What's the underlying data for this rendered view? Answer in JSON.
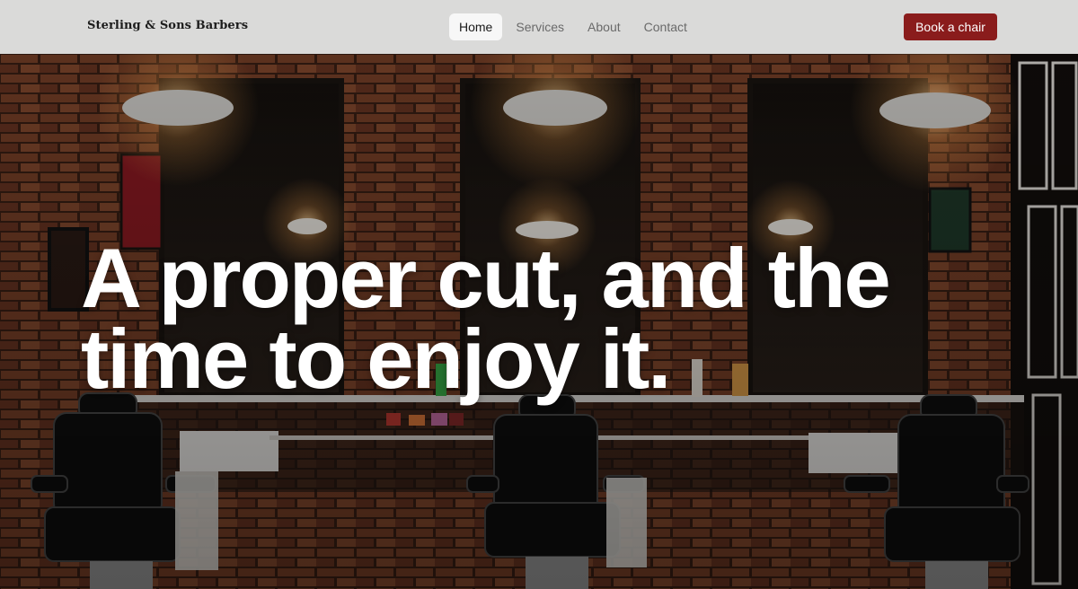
{
  "brand": {
    "name": "Sterling & Sons Barbers"
  },
  "nav": {
    "items": [
      {
        "label": "Home",
        "active": true
      },
      {
        "label": "Services",
        "active": false
      },
      {
        "label": "About",
        "active": false
      },
      {
        "label": "Contact",
        "active": false
      }
    ],
    "cta_label": "Book a chair"
  },
  "hero": {
    "headline": "A proper cut, and the time to enjoy it.",
    "image_alt": "barber-shop-interior"
  },
  "colors": {
    "nav_background": "#dadad9",
    "cta_background": "#8a1c1c",
    "headline_text": "#ffffff",
    "brick": "#6b3a26"
  }
}
